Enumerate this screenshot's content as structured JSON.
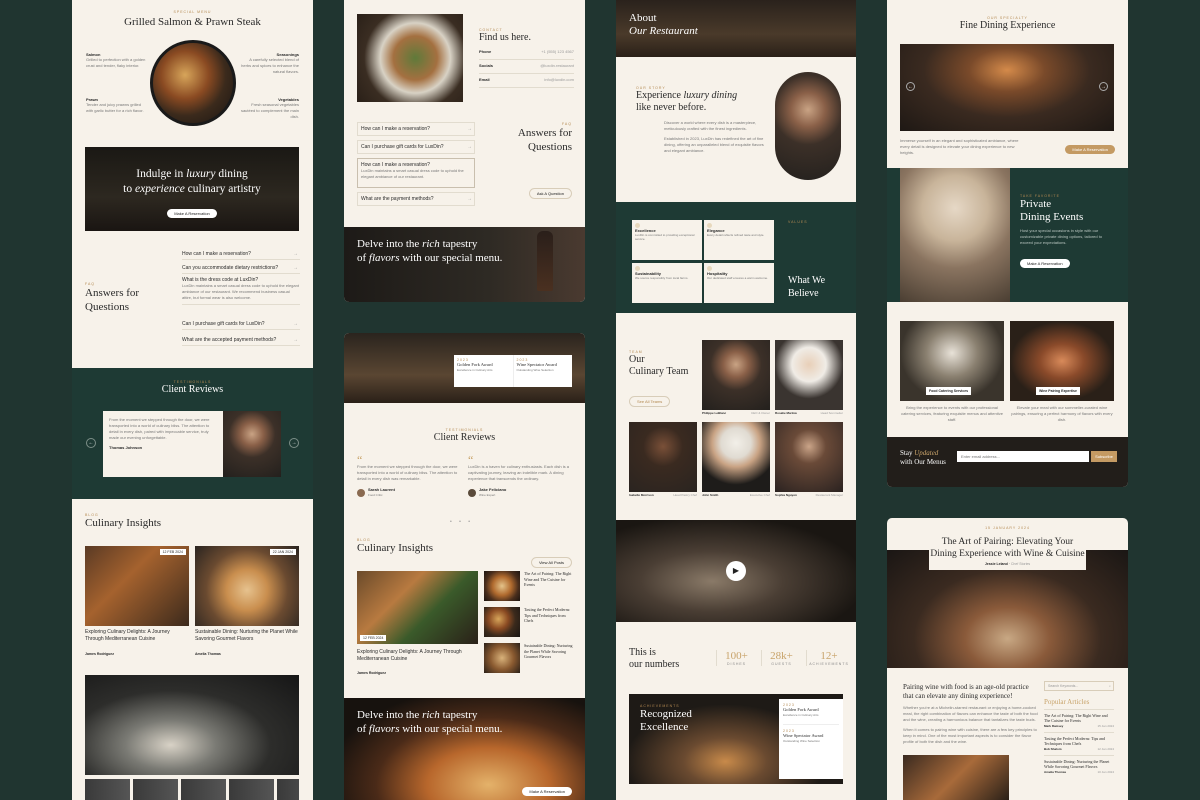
{
  "col1": {
    "dish": {
      "kicker": "Special Menu",
      "title": "Grilled Salmon & Prawn Steak",
      "items": [
        {
          "name": "Salmon",
          "desc": "Grilled to perfection with a golden crust and tender, flaky interior."
        },
        {
          "name": "Seasonings",
          "desc": "A carefully selected blend of herbs and spices to enhance the natural flavors."
        },
        {
          "name": "Prawn",
          "desc": "Tender and juicy prawns grilled with garlic butter for a rich flavor."
        },
        {
          "name": "Vegetables",
          "desc": "Fresh seasonal vegetables sautéed to complement the main dish."
        }
      ]
    },
    "banner": {
      "line1_a": "Indulge in ",
      "line1_i": "luxury",
      "line1_b": " dining",
      "line2_a": "to ",
      "line2_i": "experience",
      "line2_b": " culinary artistry",
      "button": "Make A Reservation"
    },
    "faq": {
      "kicker": "FAQ",
      "title": "Answers for Questions",
      "items": [
        "How can I make a reservation?",
        "Can you accommodate dietary restrictions?",
        "What is the dress code at LuxDin?",
        "Can I purchase gift cards for LuxDin?",
        "What are the accepted payment methods?"
      ],
      "answer": "LuxDin maintains a smart casual dress code to uphold the elegant ambiance of our restaurant. We recommend business casual attire, but formal wear is also welcome."
    },
    "reviews": {
      "kicker": "Testimonials",
      "title": "Client Reviews",
      "quote": "From the moment we stepped through the door, we were transported into a world of culinary bliss. The attention to detail in every dish, paired with impeccable service, truly made our evening unforgettable.",
      "author": "Thomas Johnson"
    },
    "blog": {
      "kicker": "Blog",
      "title": "Culinary Insights",
      "posts": [
        {
          "date": "12 FEB 2024",
          "title": "Exploring Culinary Delights: A Journey Through Mediterranean Cuisine",
          "author": "James Rodriguez"
        },
        {
          "date": "22 JAN 2024",
          "title": "Sustainable Dining: Nurturing the Planet While Savoring Gourmet Flavors",
          "author": "Amelia Thomas"
        }
      ]
    }
  },
  "col2": {
    "contact": {
      "kicker": "Contact",
      "title": "Find us here.",
      "rows": [
        {
          "label": "Phone",
          "value": "+1 (555) 123 4567"
        },
        {
          "label": "Socials",
          "value": "@luxdin.restaurant"
        },
        {
          "label": "Email",
          "value": "info@luxdin.com"
        }
      ]
    },
    "faq": {
      "kicker": "FAQ",
      "title": "Answers for Questions",
      "items": [
        "How can I make a reservation?",
        "Can I purchase gift cards for LuxDin?",
        "How can I make a reservation?",
        "What are the payment methods?"
      ],
      "answer": "LuxDin maintains a smart casual dress code to uphold the elegant ambiance of our restaurant.",
      "button": "Ask A Question"
    },
    "delve": {
      "line1_a": "Delve into the ",
      "line1_i": "rich",
      "line1_b": " tapestry",
      "line2_a": "of ",
      "line2_i": "flavors",
      "line2_b": " with our special menu."
    },
    "awards": [
      {
        "year": "2023",
        "name": "Golden Fork Award",
        "sub": "Excellence in Culinary Arts"
      },
      {
        "year": "2023",
        "name": "Wine Spectator Award",
        "sub": "Outstanding Wine Selection"
      }
    ],
    "reviews": {
      "kicker": "Testimonials",
      "title": "Client Reviews",
      "items": [
        {
          "quote": "From the moment we stepped through the door, we were transported into a world of culinary bliss. The attention to detail in every dish was remarkable.",
          "author": "Sarah Laurent",
          "role": "Food Critic"
        },
        {
          "quote": "LuxDin is a haven for culinary enthusiasts. Each dish is a captivating journey, leaving an indelible mark. A dining experience that transcends the ordinary.",
          "author": "Jake Feliciano",
          "role": "Wine Expert"
        }
      ]
    },
    "blog": {
      "kicker": "Blog",
      "title": "Culinary Insights",
      "button": "View All Posts",
      "main": {
        "date": "12 FEB 2024",
        "title": "Exploring Culinary Delights: A Journey Through Mediterranean Cuisine",
        "author": "James Rodriguez"
      },
      "side": [
        "The Art of Pairing: The Right Wine and The Cuisine for Events",
        "Tasting the Perfect Moderns: Tips and Techniques from Chefs",
        "Sustainable Dining: Nurturing the Planet While Savoring Gourmet Flavors"
      ]
    },
    "delve2": {
      "line1_a": "Delve into the ",
      "line1_i": "rich",
      "line1_b": " tapestry",
      "line2_a": "of ",
      "line2_i": "flavors",
      "line2_b": " with our special menu.",
      "button": "Make A Reservation"
    }
  },
  "col3": {
    "about": {
      "line1": "About",
      "line2": "Our Restaurant"
    },
    "story": {
      "kicker": "Our Story",
      "t1": "Experience ",
      "ti": "luxury dining",
      "t2": "like never before.",
      "p1": "Discover a world where every dish is a masterpiece, meticulously crafted with the finest ingredients.",
      "p2": "Established in 2023, LuxDin has redefined the art of fine dining, offering an unparalleled blend of exquisite flavors and elegant ambiance."
    },
    "values": {
      "kicker": "Values",
      "title": "What We Believe",
      "items": [
        {
          "name": "Excellence",
          "desc": "LuxDin is committed to providing exceptional service."
        },
        {
          "name": "Elegance",
          "desc": "Every detail reflects refined taste and style."
        },
        {
          "name": "Sustainability",
          "desc": "We source responsibly from local farms."
        },
        {
          "name": "Hospitality",
          "desc": "Our dedicated staff ensures a warm welcome."
        }
      ]
    },
    "team": {
      "kicker": "Team",
      "title1": "Our",
      "title2": "Culinary Team",
      "button": "See All Teams",
      "members": [
        {
          "name": "Philippe LeBlanc",
          "role": "CEO & Owner"
        },
        {
          "name": "Rosalie Marlow",
          "role": "Head Sommelier"
        },
        {
          "name": "Isabelle Morrison",
          "role": "Head Pastry Chef"
        },
        {
          "name": "John Smith",
          "role": "Executive Chef"
        },
        {
          "name": "Sophia Nguyen",
          "role": "Restaurant Manager"
        }
      ]
    },
    "numbers": {
      "t1": "This is",
      "t2": "our numbers",
      "stats": [
        {
          "value": "100+",
          "label": "Dishes"
        },
        {
          "value": "28k+",
          "label": "Guests"
        },
        {
          "value": "12+",
          "label": "Achievements"
        }
      ]
    },
    "recognized": {
      "kicker": "Achievements",
      "line1": "Recognized",
      "line2": "Excellence",
      "awards": [
        {
          "year": "2023",
          "name": "Golden Fork Award",
          "sub": "Excellence in Culinary Arts"
        },
        {
          "year": "2023",
          "name": "Wine Spectator Award",
          "sub": "Outstanding Wine Selection"
        }
      ]
    }
  },
  "col4": {
    "fine": {
      "kicker": "Our Specialty",
      "title": "Fine Dining Experience",
      "desc": "Immerse yourself in an elegant and sophisticated ambiance, where every detail is designed to elevate your dining experience to new heights.",
      "button": "Make A Reservation"
    },
    "private": {
      "kicker": "Take Favorite",
      "title1": "Private",
      "title2": "Dining Events",
      "desc": "Host your special occasions in style with our customizable private dining options, tailored to exceed your expectations.",
      "button": "Make A Reservation"
    },
    "services": [
      {
        "name": "Food Catering Services",
        "desc": "Bring the experience to events with our professional catering services, featuring exquisite menus and attentive staff."
      },
      {
        "name": "Wine Pairing Expertise",
        "desc": "Elevate your meal with our sommelier-curated wine pairings, ensuring a perfect harmony of flavors with every dish."
      }
    ],
    "newsletter": {
      "t1": "Stay ",
      "ti": "Updated",
      "t2": "with Our Menus",
      "placeholder": "Enter email address...",
      "button": "Subscribe"
    },
    "article": {
      "date": "15 JANUARY 2024",
      "title": "The Art of Pairing: Elevating Your Dining Experience with Wine & Cuisine",
      "author": "Jessie Leland",
      "category": "Chef Stories",
      "lead": "Pairing wine with food is an age-old practice that can elevate any dining experience!",
      "p1": "Whether you're at a Michelin-starred restaurant or enjoying a home-cooked meal, the right combination of flavors can enhance the taste of both the food and the wine, creating a harmonious balance that tantalizes the taste buds.",
      "p2": "When it comes to pairing wine with cuisine, there are a few key principles to keep in mind. One of the most important aspects is to consider the flavor profile of both the dish and the wine.",
      "search": "Search Keywords...",
      "popular": "Popular Articles",
      "side": [
        {
          "title": "The Art of Pairing: The Right Wine and The Cuisine for Events",
          "author": "Mark Ramsey",
          "date": "15 Jan 2024"
        },
        {
          "title": "Tasting the Perfect Moderns: Tips and Techniques from Chefs",
          "author": "Bob Shalom",
          "date": "12 Jan 2024"
        },
        {
          "title": "Sustainable Dining: Nurturing the Planet While Savoring Gourmet Flavors",
          "author": "Amelia Thomas",
          "date": "10 Jan 2024"
        }
      ]
    }
  }
}
